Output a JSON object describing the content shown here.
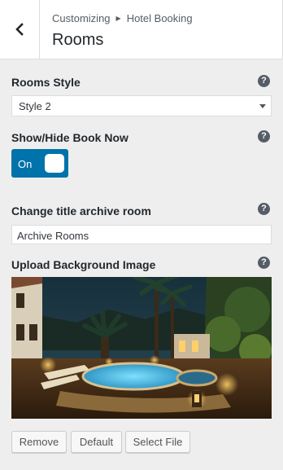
{
  "header": {
    "breadcrumb_parent": "Customizing",
    "breadcrumb_child": "Hotel Booking",
    "title": "Rooms"
  },
  "rooms_style": {
    "label": "Rooms Style",
    "selected": "Style 2"
  },
  "book_now": {
    "label": "Show/Hide Book Now",
    "toggle_label": "On",
    "enabled": true
  },
  "archive_title": {
    "label": "Change title archive room",
    "value": "Archive Rooms"
  },
  "background_image": {
    "label": "Upload Background Image",
    "remove_label": "Remove",
    "default_label": "Default",
    "select_label": "Select File"
  },
  "help_glyph": "?",
  "colors": {
    "accent": "#0073aa",
    "background": "#eeeeee"
  }
}
